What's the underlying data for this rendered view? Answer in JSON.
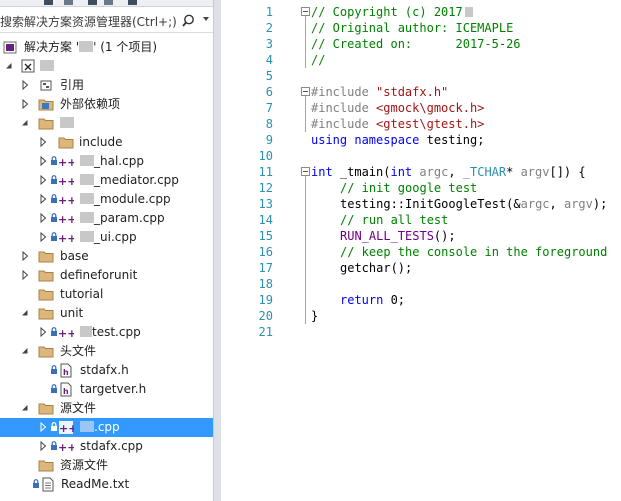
{
  "explorer": {
    "search_placeholder": "搜索解决方案资源管理器(Ctrl+;)",
    "solution_label_prefix": "解决方案 '",
    "solution_label_suffix": "' (1 个项目)",
    "items": [
      {
        "label": "引用"
      },
      {
        "label": "外部依赖项"
      },
      {
        "label": "include"
      },
      {
        "label": "_hal.cpp"
      },
      {
        "label": "_mediator.cpp"
      },
      {
        "label": "_module.cpp"
      },
      {
        "label": "_param.cpp"
      },
      {
        "label": "_ui.cpp"
      },
      {
        "label": "base"
      },
      {
        "label": "defineforunit"
      },
      {
        "label": "tutorial"
      },
      {
        "label": "unit"
      },
      {
        "label": "test.cpp"
      },
      {
        "label": "头文件"
      },
      {
        "label": "stdafx.h"
      },
      {
        "label": "targetver.h"
      },
      {
        "label": "源文件"
      },
      {
        "label": ".cpp"
      },
      {
        "label": "stdafx.cpp"
      },
      {
        "label": "资源文件"
      },
      {
        "label": "ReadMe.txt"
      }
    ]
  },
  "editor": {
    "line_numbers": [
      "1",
      "2",
      "3",
      "4",
      "5",
      "6",
      "7",
      "8",
      "9",
      "10",
      "11",
      "12",
      "13",
      "14",
      "15",
      "16",
      "17",
      "18",
      "19",
      "20",
      "21"
    ],
    "lines": {
      "l1": "// Copyright (c) 2017",
      "l2": "// Original author: ICEMAPLE",
      "l3": "// Created on:      2017-5-26",
      "l4": "//",
      "l6_kw": "#include ",
      "l6_str": "\"stdafx.h\"",
      "l7_kw": "#include ",
      "l7_str": "<gmock\\gmock.h>",
      "l8_kw": "#include ",
      "l8_str": "<gtest\\gtest.h>",
      "l9_kw1": "using",
      "l9_kw2": "namespace",
      "l9_rest": " testing;",
      "l11_kw": "int",
      "l11_a": " _tmain(",
      "l11_kw2": "int",
      "l11_b": " ",
      "l11_argc": "argc",
      "l11_c": ", ",
      "l11_type": "_TCHAR",
      "l11_d": "* ",
      "l11_argv": "argv",
      "l11_e": "[]) {",
      "l12": "// init google test",
      "l13_a": "testing::InitGoogleTest(&",
      "l13_argc": "argc",
      "l13_b": ", ",
      "l13_argv": "argv",
      "l13_c": ");",
      "l14": "// run all test",
      "l15_mac": "RUN_ALL_TESTS",
      "l15_rest": "();",
      "l16": "// keep the console in the foreground",
      "l17": "getchar();",
      "l19_kw": "return",
      "l19_rest": " 0;",
      "l20": "}"
    }
  }
}
